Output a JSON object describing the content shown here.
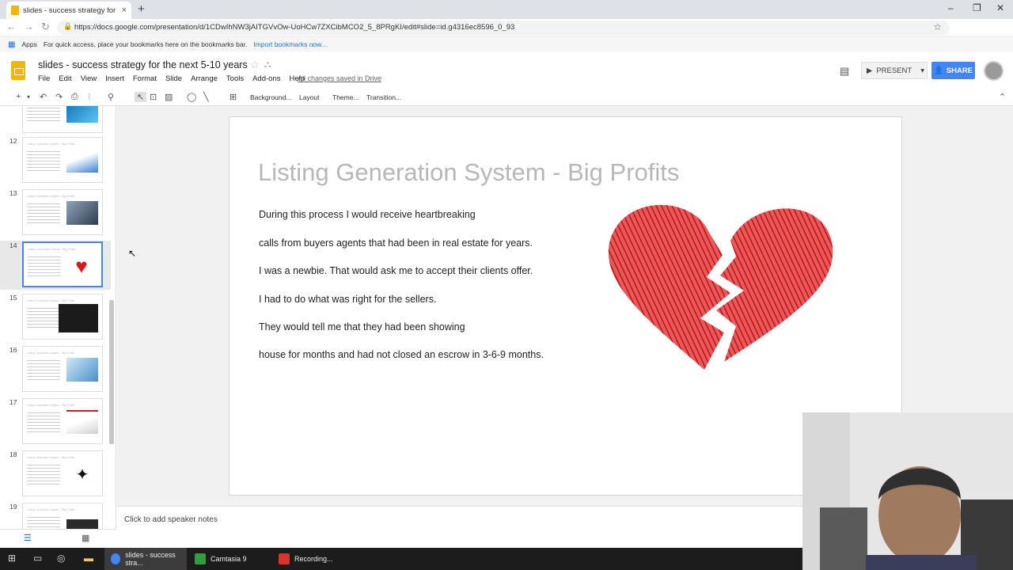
{
  "browser": {
    "tab_title": "slides - success strategy for the n",
    "tab_close": "×",
    "new_tab": "+",
    "url": "https://docs.google.com/presentation/d/1CDwIhNW3jAITGVvOw-UoHCw7ZXCibMCO2_5_8PRgKI/edit#slide=id.g4316ec8596_0_93",
    "bookmarks_apps": "Apps",
    "bookmarks_hint": "For quick access, place your bookmarks here on the bookmarks bar.",
    "bookmarks_import": "Import bookmarks now..."
  },
  "doc": {
    "title": "slides - success strategy for the next 5-10 years",
    "menus": [
      "File",
      "Edit",
      "View",
      "Insert",
      "Format",
      "Slide",
      "Arrange",
      "Tools",
      "Add-ons",
      "Help"
    ],
    "save_status": "All changes saved in Drive",
    "present_label": "PRESENT",
    "share_label": "SHARE"
  },
  "toolbar": {
    "background": "Background...",
    "layout": "Layout",
    "theme": "Theme...",
    "transition": "Transition..."
  },
  "thumbnails": [
    {
      "num": "12",
      "title": "Listing Generation System - Big Profits"
    },
    {
      "num": "13",
      "title": "Listing Generation System - Big Profits"
    },
    {
      "num": "14",
      "title": "Listing Generation System - Big Profits"
    },
    {
      "num": "15",
      "title": "Listing Generation System - Big Profits"
    },
    {
      "num": "16",
      "title": "Listing Generation System - Big Profits"
    },
    {
      "num": "17",
      "title": "Listing Generation System - Big Profits"
    },
    {
      "num": "18",
      "title": "Listing Generation System - Big Profits"
    },
    {
      "num": "19",
      "title": "Listing Generation System - Big Profits"
    }
  ],
  "slide": {
    "title": "Listing Generation System - Big Profits",
    "lines": [
      "During this process I would receive heartbreaking",
      "calls from buyers agents that had been in real estate for years.",
      "I was a newbie.  That would ask me to accept their clients offer.",
      "I had to do what was right for the sellers.",
      "They would tell me that they had been showing",
      "house for months and had not closed an escrow in 3-6-9 months."
    ]
  },
  "notes": {
    "placeholder": "Click to add speaker notes"
  },
  "taskbar": {
    "chrome": "slides - success stra...",
    "camtasia": "Camtasia 9",
    "recording": "Recording..."
  },
  "colors": {
    "accent": "#4285f4",
    "slides_yellow": "#f4b400",
    "heart_red": "#d71920"
  }
}
